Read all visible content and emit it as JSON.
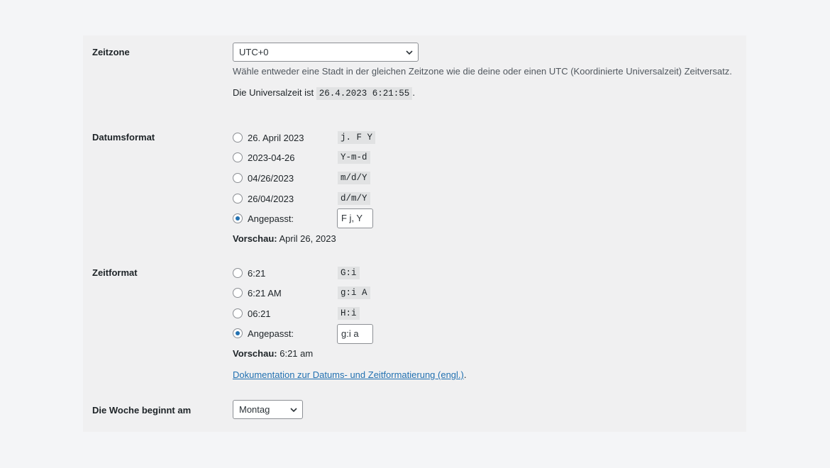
{
  "timezone": {
    "label": "Zeitzone",
    "selected": "UTC+0",
    "description": "Wähle entweder eine Stadt in der gleichen Zeitzone wie die deine oder einen UTC (Koordinierte Universalzeit) Zeitversatz.",
    "universal_prefix": "Die Universalzeit ist",
    "universal_time": "26.4.2023 6:21:55",
    "universal_suffix": "."
  },
  "date_format": {
    "label": "Datumsformat",
    "options": [
      {
        "label": "26. April 2023",
        "format": "j. F Y",
        "checked": false
      },
      {
        "label": "2023-04-26",
        "format": "Y-m-d",
        "checked": false
      },
      {
        "label": "04/26/2023",
        "format": "m/d/Y",
        "checked": false
      },
      {
        "label": "26/04/2023",
        "format": "d/m/Y",
        "checked": false
      }
    ],
    "custom_label": "Angepasst:",
    "custom_value": "F j, Y",
    "custom_checked": true,
    "preview_label": "Vorschau:",
    "preview_value": "April 26, 2023"
  },
  "time_format": {
    "label": "Zeitformat",
    "options": [
      {
        "label": "6:21",
        "format": "G:i",
        "checked": false
      },
      {
        "label": "6:21 AM",
        "format": "g:i A",
        "checked": false
      },
      {
        "label": "06:21",
        "format": "H:i",
        "checked": false
      }
    ],
    "custom_label": "Angepasst:",
    "custom_value": "g:i a",
    "custom_checked": true,
    "preview_label": "Vorschau:",
    "preview_value": "6:21 am",
    "doc_link": "Dokumentation zur Datums- und Zeitformatierung (engl.)",
    "doc_suffix": "."
  },
  "week_start": {
    "label": "Die Woche beginnt am",
    "selected": "Montag"
  },
  "colors": {
    "page_bg": "#f4f5f7",
    "panel_bg": "#f0f0f1",
    "accent": "#2271b1",
    "code_bg": "#e1e2e3"
  }
}
